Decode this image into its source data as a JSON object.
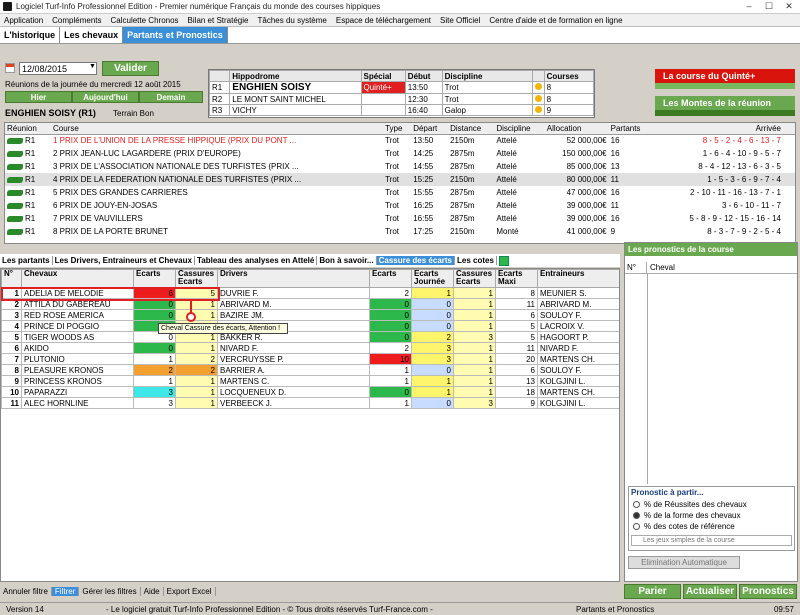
{
  "window": {
    "title": "Logiciel Turf-Info Professionnel Edition - Premier numérique Français du monde des courses hippiques"
  },
  "menu": [
    "Application",
    "Compléments",
    "Calculette Chronos",
    "Bilan et Stratégie",
    "Tâches du système",
    "Espace de téléchargement",
    "Site Officiel",
    "Centre d'aide et de formation en ligne"
  ],
  "nav_tabs": [
    "L'historique",
    "Les chevaux",
    "Partants et Pronostics"
  ],
  "date": {
    "value": "12/08/2015",
    "validate": "Valider",
    "reunions": "Réunions de la journée du mercredi 12 août 2015",
    "hier": "Hier",
    "aujourdhui": "Aujourd'hui",
    "demain": "Demain"
  },
  "track": {
    "name": "ENGHIEN SOISY (R1)",
    "terrain": "Terrain Bon"
  },
  "hippodromes": {
    "headers": [
      "",
      "Hippodrome",
      "Spécial",
      "Début",
      "Discipline",
      "",
      "Courses"
    ],
    "rows": [
      {
        "r": "R1",
        "name": "ENGHIEN SOISY",
        "special": "Quinté+",
        "debut": "13:50",
        "discipline": "Trot",
        "courses": "8"
      },
      {
        "r": "R2",
        "name": "LE MONT SAINT MICHEL",
        "special": "",
        "debut": "12:30",
        "discipline": "Trot",
        "courses": "8"
      },
      {
        "r": "R3",
        "name": "VICHY",
        "special": "",
        "debut": "16:40",
        "discipline": "Galop",
        "courses": "9"
      }
    ]
  },
  "buttons": {
    "quinte": "La course du Quinté+",
    "montes": "Les Montes de la réunion"
  },
  "races": {
    "headers": [
      "Réunion",
      "Course",
      "Type",
      "Départ",
      "Distance",
      "Discipline",
      "Allocation",
      "Partants",
      "Arrivée"
    ],
    "rows": [
      {
        "r": "R1",
        "course": "1 PRIX DE L'UNION DE LA PRESSE HIPPIQUE (PRIX DU PONT ...",
        "type": "Trot",
        "depart": "13:50",
        "distance": "2150m",
        "discipline": "Attelé",
        "allocation": "52 000,00€",
        "partants": "16",
        "arrivee": "8 - 5 - 2 - 4 - 6 - 13 - 7",
        "quinte": true
      },
      {
        "r": "R1",
        "course": "2 PRIX JEAN-LUC LAGARDERE (PRIX D'EUROPE)",
        "type": "Trot",
        "depart": "14:25",
        "distance": "2875m",
        "discipline": "Attelé",
        "allocation": "150 000,00€",
        "partants": "16",
        "arrivee": "1 - 6 - 4 - 10 - 9 - 5 - 7"
      },
      {
        "r": "R1",
        "course": "3 PRIX DE L'ASSOCIATION NATIONALE DES TURFISTES (PRIX ...",
        "type": "Trot",
        "depart": "14:55",
        "distance": "2875m",
        "discipline": "Attelé",
        "allocation": "85 000,00€",
        "partants": "13",
        "arrivee": "8 - 4 - 12 - 13 - 6 - 3 - 5"
      },
      {
        "r": "R1",
        "course": "4 PRIX DE LA FEDERATION NATIONALE DES TURFISTES (PRIX ...",
        "type": "Trot",
        "depart": "15:25",
        "distance": "2150m",
        "discipline": "Attelé",
        "allocation": "80 000,00€",
        "partants": "11",
        "arrivee": "1 - 5 - 3 - 6 - 9 - 7 - 4",
        "selected": true
      },
      {
        "r": "R1",
        "course": "5 PRIX DES GRANDES CARRIERES",
        "type": "Trot",
        "depart": "15:55",
        "distance": "2875m",
        "discipline": "Attelé",
        "allocation": "47 000,00€",
        "partants": "16",
        "arrivee": "2 - 10 - 11 - 16 - 13 - 7 - 1"
      },
      {
        "r": "R1",
        "course": "6 PRIX DE JOUY-EN-JOSAS",
        "type": "Trot",
        "depart": "16:25",
        "distance": "2875m",
        "discipline": "Attelé",
        "allocation": "39 000,00€",
        "partants": "11",
        "arrivee": "3 - 6 - 10 - 11 - 7"
      },
      {
        "r": "R1",
        "course": "7 PRIX DE VAUVILLERS",
        "type": "Trot",
        "depart": "16:55",
        "distance": "2875m",
        "discipline": "Attelé",
        "allocation": "39 000,00€",
        "partants": "16",
        "arrivee": "5 - 8 - 9 - 12 - 15 - 16 - 14"
      },
      {
        "r": "R1",
        "course": "8 PRIX DE LA PORTE BRUNET",
        "type": "Trot",
        "depart": "17:25",
        "distance": "2150m",
        "discipline": "Monté",
        "allocation": "41 000,00€",
        "partants": "9",
        "arrivee": "8 - 3 - 7 - 9 - 2 - 5 - 4"
      }
    ]
  },
  "sub_tabs": [
    "Les partants",
    "Les Drivers, Entraineurs et Chevaux",
    "Tableau des analyses en Attelé",
    "Bon à savoir...",
    "Cassure des écarts",
    "Les cotes"
  ],
  "partants": {
    "headers": [
      "N°",
      "Chevaux",
      "Ecarts",
      "Cassures Ecarts",
      "Drivers",
      "Ecarts",
      "Ecarts Journée",
      "Cassures Ecarts",
      "Ecarts Maxi",
      "Entraineurs"
    ],
    "rows": [
      {
        "n": "1",
        "cheval": "ADELIA DE MELODIE",
        "e1": "6",
        "c1": "5",
        "driver": "DUVRIE F.",
        "e2": "2",
        "ej": "1",
        "c2": "1",
        "em": "8",
        "ent": "MEUNIER S.",
        "e1c": "red-cell",
        "c1c": "",
        "e2c": "",
        "ejc": "yellow-cell"
      },
      {
        "n": "2",
        "cheval": "ATTILA DU GABEREAU",
        "e1": "0",
        "c1": "1",
        "driver": "ABRIVARD M.",
        "e2": "0",
        "ej": "0",
        "c2": "1",
        "em": "11",
        "ent": "ABRIVARD M.",
        "e1c": "green-cell",
        "c1c": "",
        "e2c": "green-cell",
        "ejc": "blue-cell"
      },
      {
        "n": "3",
        "cheval": "RED ROSE AMERICA",
        "e1": "0",
        "c1": "1",
        "driver": "BAZIRE JM.",
        "e2": "0",
        "ej": "0",
        "c2": "1",
        "em": "6",
        "ent": "SOULOY F.",
        "e1c": "green-cell",
        "c1c": "",
        "e2c": "green-cell",
        "ejc": "blue-cell"
      },
      {
        "n": "4",
        "cheval": "PRINCE DI POGGIO",
        "e1": "0",
        "c1": "1",
        "driver": "DUBOIS JP.",
        "e2": "0",
        "ej": "0",
        "c2": "1",
        "em": "5",
        "ent": "LACROIX V.",
        "e1c": "green-cell",
        "c1c": "",
        "e2c": "green-cell",
        "ejc": "blue-cell"
      },
      {
        "n": "5",
        "cheval": "TIGER WOODS AS",
        "e1": "0",
        "c1": "1",
        "driver": "BAKKER R.",
        "e2": "0",
        "ej": "2",
        "c2": "3",
        "em": "5",
        "ent": "HAGOORT P.",
        "e1c": "",
        "c1c": "",
        "e2c": "green-cell",
        "ejc": "yellow-cell"
      },
      {
        "n": "6",
        "cheval": "AKIDO",
        "e1": "0",
        "c1": "1",
        "driver": "NIVARD F.",
        "e2": "2",
        "ej": "3",
        "c2": "1",
        "em": "11",
        "ent": "NIVARD F.",
        "e1c": "green-cell",
        "c1c": "",
        "e2c": "",
        "ejc": "yellow-cell"
      },
      {
        "n": "7",
        "cheval": "PLUTONIO",
        "e1": "1",
        "c1": "2",
        "driver": "VERCRUYSSE P.",
        "e2": "10",
        "ej": "3",
        "c2": "1",
        "em": "20",
        "ent": "MARTENS CH.",
        "e1c": "",
        "c1c": "",
        "e2c": "red-cell",
        "ejc": "yellow-cell"
      },
      {
        "n": "8",
        "cheval": "PLEASURE KRONOS",
        "e1": "2",
        "c1": "2",
        "driver": "BARRIER A.",
        "e2": "1",
        "ej": "0",
        "c2": "1",
        "em": "6",
        "ent": "SOULOY F.",
        "e1c": "orange-cell",
        "c1c": "orange-cell",
        "e2c": "",
        "ejc": "blue-cell"
      },
      {
        "n": "9",
        "cheval": "PRINCESS KRONOS",
        "e1": "1",
        "c1": "1",
        "driver": "MARTENS C.",
        "e2": "1",
        "ej": "1",
        "c2": "1",
        "em": "13",
        "ent": "KOLGJINI L.",
        "e1c": "",
        "c1c": "",
        "e2c": "",
        "ejc": "yellow-cell"
      },
      {
        "n": "10",
        "cheval": "PAPARAZZI",
        "e1": "3",
        "c1": "1",
        "driver": "LOCQUENEUX D.",
        "e2": "0",
        "ej": "1",
        "c2": "1",
        "em": "18",
        "ent": "MARTENS CH.",
        "e1c": "cyan-cell",
        "c1c": "",
        "e2c": "green-cell",
        "ejc": "yellow-cell"
      },
      {
        "n": "11",
        "cheval": "ALEC HORNLINE",
        "e1": "3",
        "c1": "1",
        "driver": "VERBEECK J.",
        "e2": "1",
        "ej": "0",
        "c2": "3",
        "em": "9",
        "ent": "KOLGJINI L.",
        "e1c": "",
        "c1c": "",
        "e2c": "",
        "ejc": "blue-cell"
      }
    ]
  },
  "tooltip": "Cheval Cassure des écarts, Attention !",
  "pronostics": {
    "title": "Les pronostics de la course",
    "col_n": "N°",
    "col_cheval": "Cheval",
    "partir_title": "Pronostic à partir...",
    "options": [
      "% de Réussites des chevaux",
      "% de la forme des chevaux",
      "% des cotes de référence"
    ],
    "selected_option": 1,
    "jeux_placeholder": "Les jeux simples de la course",
    "elim": "Elimination Automatique",
    "parier": "Parier",
    "actualiser": "Actualiser",
    "pronostics_btn": "Pronostics"
  },
  "bottom": [
    "Annuler filtre",
    "Filtrer",
    "Gérer les filtres",
    "Aide",
    "Export Excel"
  ],
  "status": {
    "version": "Version 14",
    "copyright": "- Le logiciel gratuit Turf-Info Professionnel Edition - © Tous droits réservés Turf-France.com -",
    "section": "Partants et Pronostics",
    "time": "09:57"
  }
}
